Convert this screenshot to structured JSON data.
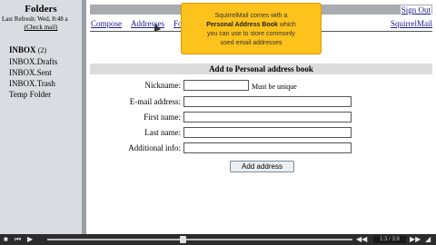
{
  "sidebar": {
    "title": "Folders",
    "last_refresh": "Last Refresh: Wed, 8:48 a",
    "check_mail": "(Check mail)",
    "folders": [
      {
        "name": "INBOX",
        "count": "(2)"
      },
      {
        "name": "INBOX.Drafts",
        "count": ""
      },
      {
        "name": "INBOX.Sent",
        "count": ""
      },
      {
        "name": "INBOX.Trash",
        "count": ""
      },
      {
        "name": "Temp Folder",
        "count": ""
      }
    ]
  },
  "header": {
    "signout": "Sign Out",
    "menu": [
      "Compose",
      "Addresses",
      "Fo",
      "SquirrelMail"
    ]
  },
  "tooltip": {
    "line1": "SquirrelMail comes with a",
    "bold": "Personal Address Book",
    "line2_suffix": " which",
    "line3": "you can use to store commonly",
    "line4": "used email addresses"
  },
  "form": {
    "section_title": "Add to Personal address book",
    "fields": [
      {
        "label": "Nickname:",
        "value": ""
      },
      {
        "label": "E-mail address:",
        "value": ""
      },
      {
        "label": "First name:",
        "value": ""
      },
      {
        "label": "Last name:",
        "value": ""
      },
      {
        "label": "Additional info:",
        "value": ""
      }
    ],
    "nickname_hint": "Must be unique",
    "submit": "Add address"
  },
  "player": {
    "time": "1:3 / 3:8"
  }
}
